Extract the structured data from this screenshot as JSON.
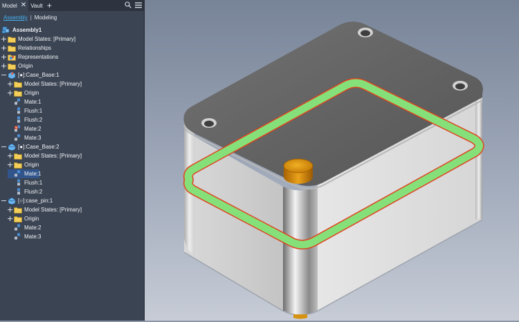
{
  "model_browser": {
    "tabs": [
      {
        "label": "Model"
      },
      {
        "label": "Vault"
      }
    ],
    "close_glyph": "✕",
    "add_glyph": "+",
    "subtabs": [
      {
        "label": "Assembly"
      },
      {
        "label": "Modeling"
      }
    ],
    "tree": [
      {
        "label": "Assembly1",
        "icon": "assembly-icon",
        "level": 0
      },
      {
        "label": "Model States: [Primary]",
        "icon": "folder-icon",
        "level": 1
      },
      {
        "label": "Relationships",
        "icon": "folder-icon",
        "level": 1
      },
      {
        "label": "Representations",
        "icon": "representations-icon",
        "level": 1
      },
      {
        "label": "Origin",
        "icon": "folder-icon",
        "level": 1
      },
      {
        "label": "[●]:Case_Base:1",
        "icon": "part-grounded-icon",
        "level": 1
      },
      {
        "label": "Model States: [Primary]",
        "icon": "folder-icon",
        "level": 2
      },
      {
        "label": "Origin",
        "icon": "folder-icon",
        "level": 2
      },
      {
        "label": "Mate:1",
        "icon": "mate-icon",
        "level": 2
      },
      {
        "label": "Flush:1",
        "icon": "flush-icon",
        "level": 2
      },
      {
        "label": "Flush:2",
        "icon": "flush-icon",
        "level": 2
      },
      {
        "label": "Mate:2",
        "icon": "mate-error-icon",
        "level": 2
      },
      {
        "label": "Mate:3",
        "icon": "mate-icon",
        "level": 2
      },
      {
        "label": "[●]:Case_Base:2",
        "icon": "part-icon",
        "level": 1
      },
      {
        "label": "Model States: [Primary]",
        "icon": "folder-icon",
        "level": 2
      },
      {
        "label": "Origin",
        "icon": "folder-icon",
        "level": 2
      },
      {
        "label": "Mate:1",
        "icon": "mate-icon",
        "level": 2,
        "selected": true
      },
      {
        "label": "Flush:1",
        "icon": "flush-icon",
        "level": 2
      },
      {
        "label": "Flush:2",
        "icon": "flush-icon",
        "level": 2
      },
      {
        "label": "[○]:case_pin:1",
        "icon": "part-icon",
        "level": 1
      },
      {
        "label": "Model States: [Primary]",
        "icon": "folder-icon",
        "level": 2
      },
      {
        "label": "Origin",
        "icon": "folder-icon",
        "level": 2
      },
      {
        "label": "Mate:2",
        "icon": "mate-icon",
        "level": 2
      },
      {
        "label": "Mate:3",
        "icon": "mate-icon",
        "level": 2
      }
    ]
  },
  "colors": {
    "panel_bg": "#3b4453",
    "selection": "#31558b",
    "active_subtab": "#46b1f0",
    "highlight_green": "#86e07a",
    "highlight_red": "#e0431f",
    "pin_orange": "#e49a12"
  }
}
